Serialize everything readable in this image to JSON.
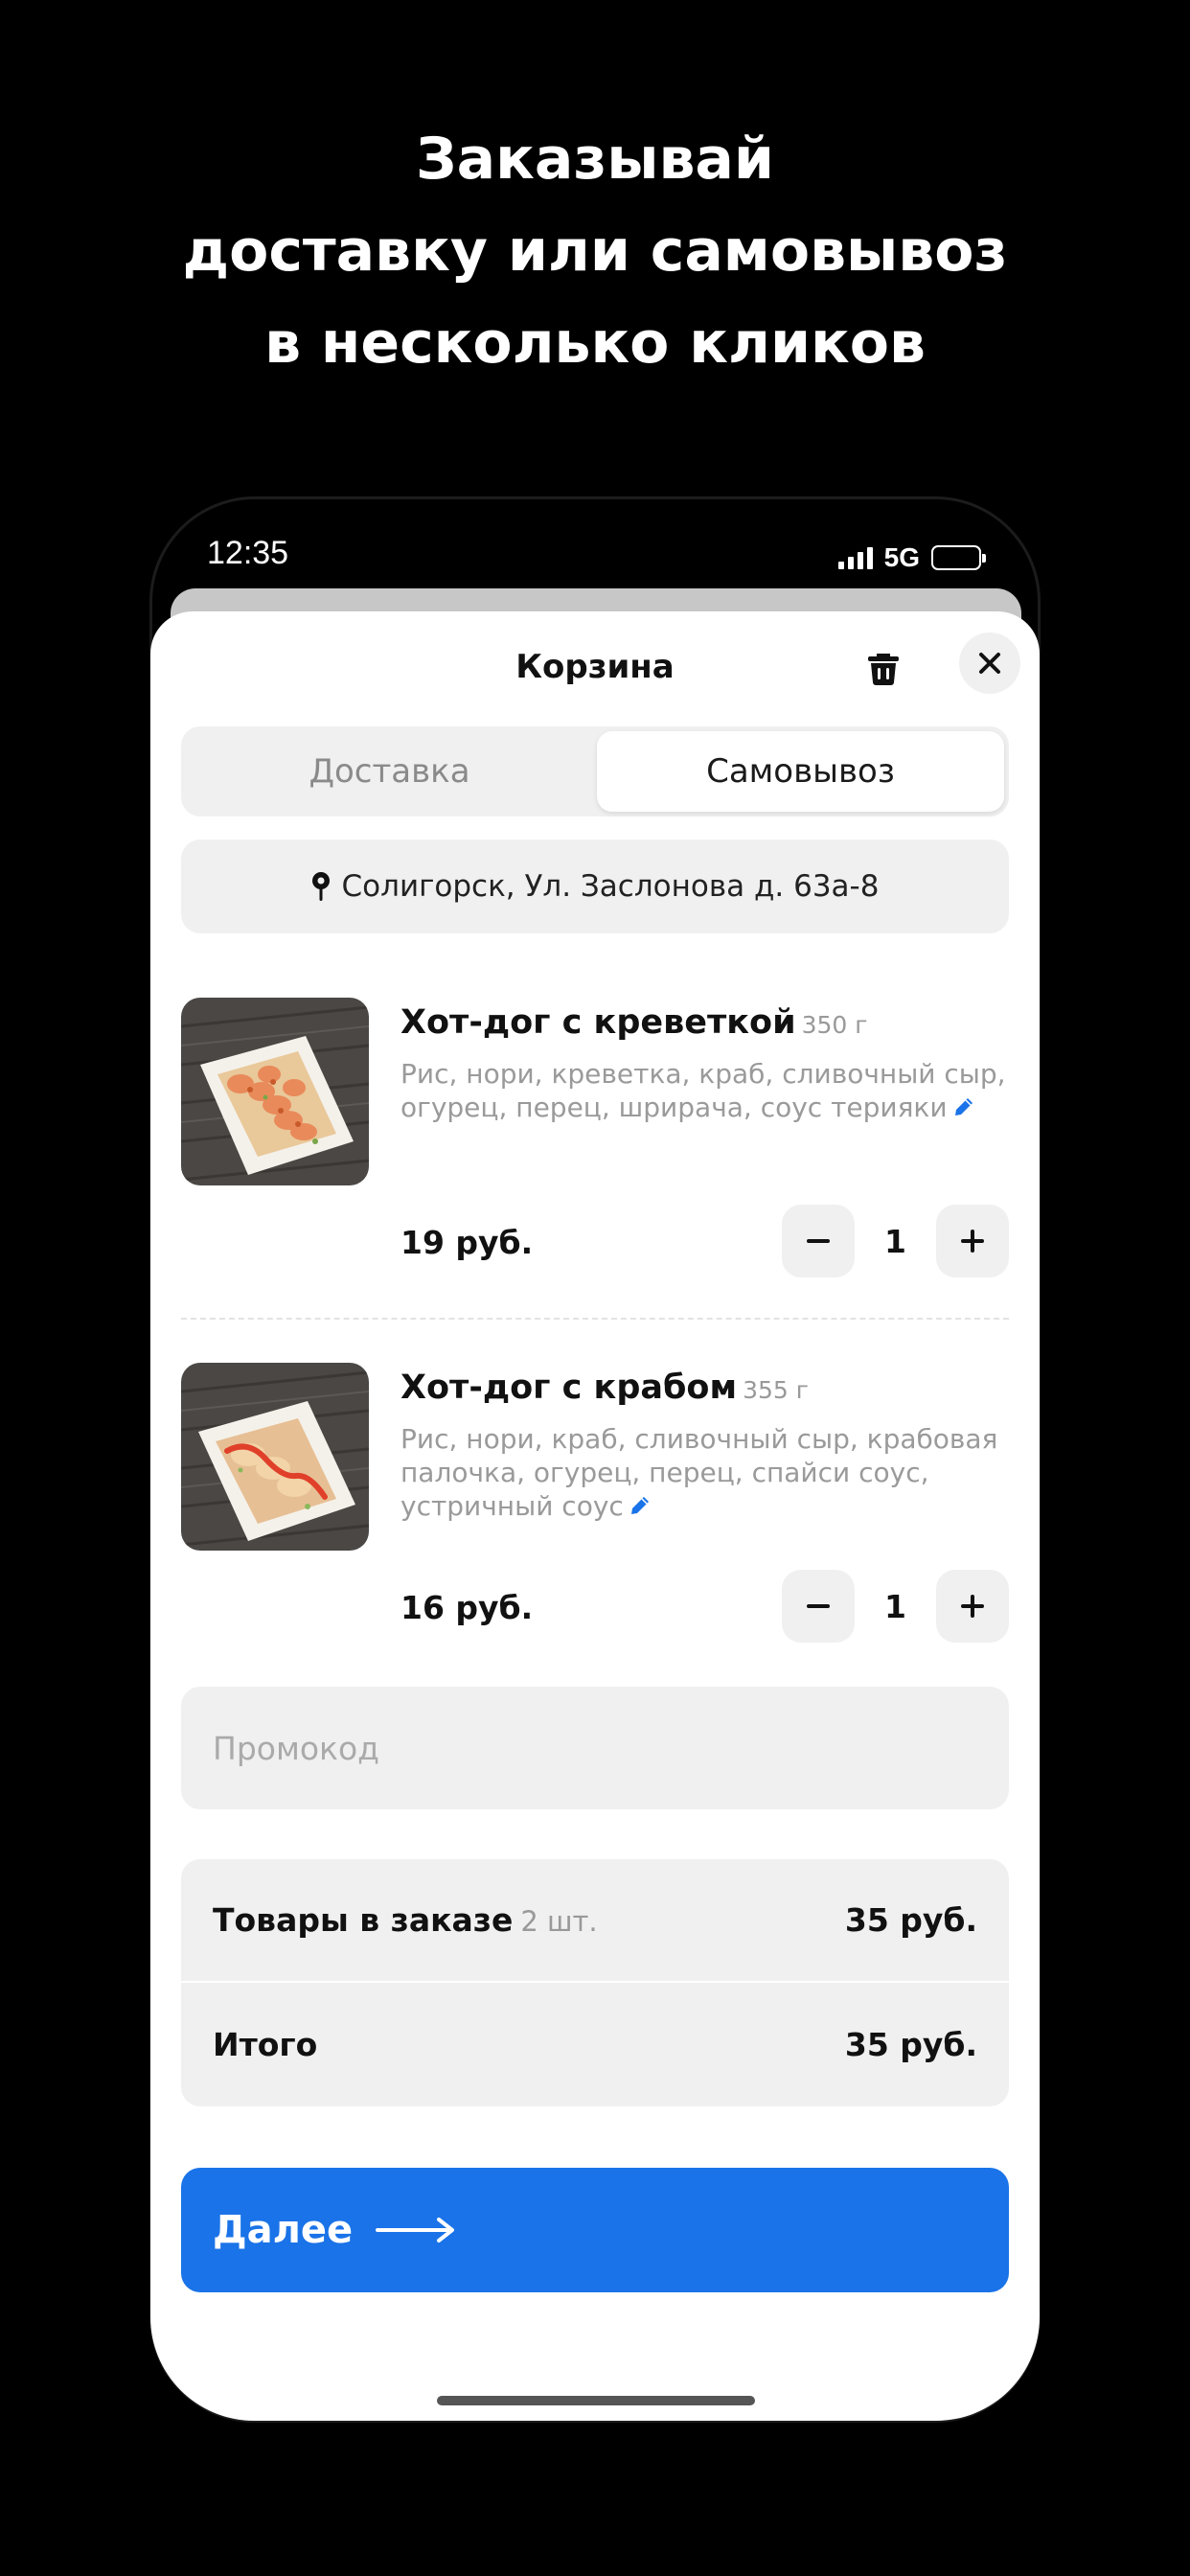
{
  "headline": {
    "line1": "Заказывай",
    "line2": "доставку или самовывоз",
    "line3": "в несколько кликов"
  },
  "status_bar": {
    "time": "12:35",
    "network": "5G"
  },
  "cart": {
    "title": "Корзина",
    "tabs": [
      {
        "label": "Доставка",
        "selected": false
      },
      {
        "label": "Самовывоз",
        "selected": true
      }
    ],
    "address": "Солигорск, Ул. Заслонова д. 63а-8",
    "items": [
      {
        "name": "Хот-дог с креветкой",
        "weight": "350 г",
        "description": "Рис, нори, креветка, краб, сливочный сыр, огурец, перец, шрирача, соус терияки",
        "price": "19 руб.",
        "quantity": "1"
      },
      {
        "name": "Хот-дог с крабом",
        "weight": "355 г",
        "description": "Рис, нори, краб, сливочный сыр, крабовая палочка, огурец, перец, спайси соус, устричный соус",
        "price": "16 руб.",
        "quantity": "1"
      }
    ],
    "promo_placeholder": "Промокод",
    "summary": {
      "items_label": "Товары в заказе",
      "items_count": "2 шт.",
      "items_total": "35 руб.",
      "total_label": "Итого",
      "total_value": "35 руб."
    },
    "next_label": "Далее"
  },
  "colors": {
    "accent": "#1a73e8",
    "edit_icon": "#1a73e8",
    "background": "#000000",
    "surface": "#f0f0f0"
  },
  "icons": [
    "signal-icon",
    "battery-icon",
    "trash-icon",
    "close-icon",
    "location-pin-icon",
    "edit-pencil-icon",
    "minus-icon",
    "plus-icon",
    "arrow-right-icon"
  ]
}
